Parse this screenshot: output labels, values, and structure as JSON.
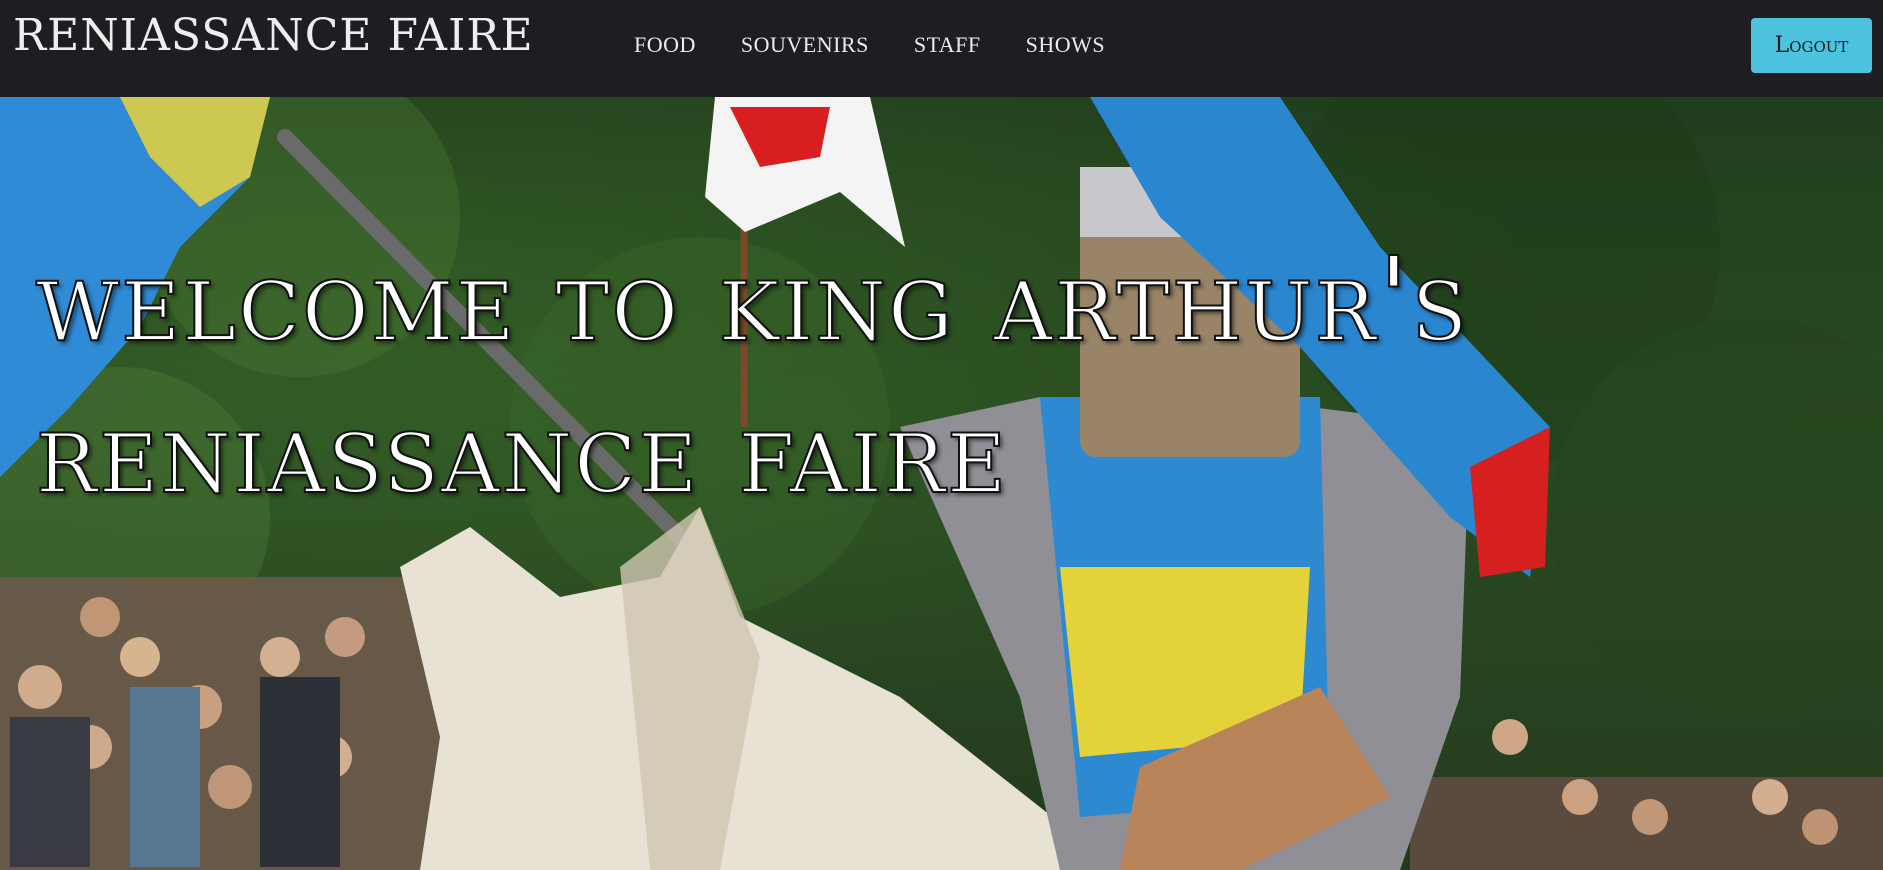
{
  "navbar": {
    "brand": "RENIASSANCE FAIRE",
    "links": [
      {
        "label": "FOOD"
      },
      {
        "label": "SOUVENIRS"
      },
      {
        "label": "STAFF"
      },
      {
        "label": "SHOWS"
      }
    ],
    "logout_label": "Logout"
  },
  "hero": {
    "title": "Welcome to King Arthur's Reniassance Faire"
  },
  "colors": {
    "navbar_bg": "#1e1d22",
    "logout_button_bg": "#4ec3e0",
    "nav_text": "#ececec",
    "hero_title_text": "#ffffff"
  }
}
